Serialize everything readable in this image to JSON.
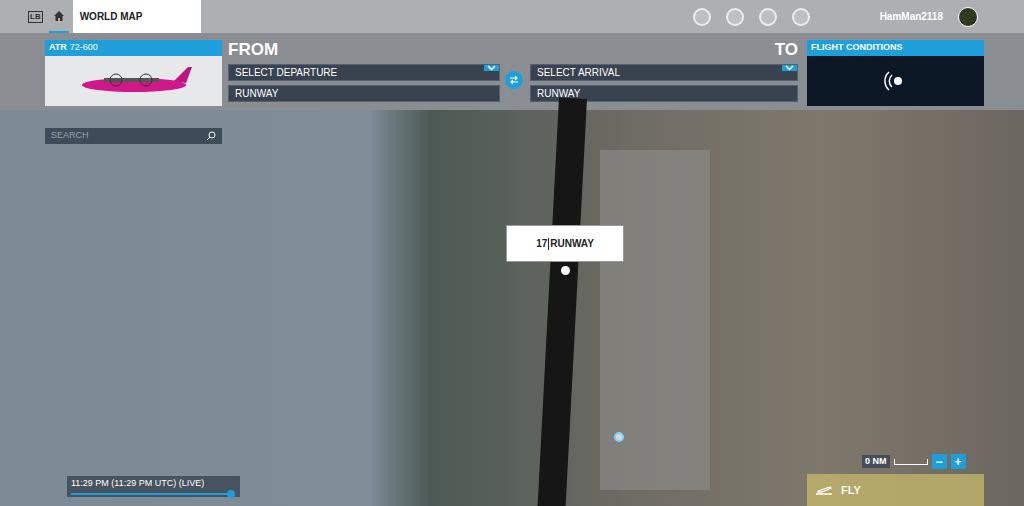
{
  "window": {
    "title": "WORLD MAP"
  },
  "top_bar": {
    "controller_button": "LB",
    "username": "HamMan2118"
  },
  "aircraft": {
    "maker": "ATR",
    "model": "72-600"
  },
  "from": {
    "label": "FROM",
    "departure": "SELECT DEPARTURE",
    "runway": "RUNWAY"
  },
  "to": {
    "label": "TO",
    "arrival": "SELECT ARRIVAL",
    "runway": "RUNWAY"
  },
  "flight_conditions": {
    "label": "FLIGHT CONDITIONS"
  },
  "search": {
    "placeholder": "SEARCH"
  },
  "map": {
    "runway_label": {
      "number": "17",
      "text": "RUNWAY"
    }
  },
  "time": {
    "text": "11:29 PM (11:29 PM UTC) (LIVE)",
    "level": 1.0
  },
  "scale": {
    "text": "0 NM",
    "zoom_out": "−",
    "zoom_in": "+"
  },
  "fly_button": {
    "label": "FLY",
    "disabled": true
  }
}
